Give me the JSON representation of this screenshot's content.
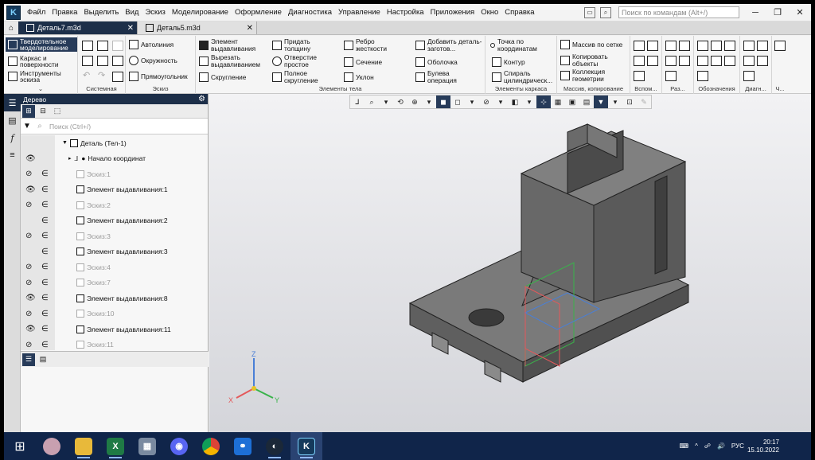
{
  "menu": {
    "items": [
      "Файл",
      "Правка",
      "Выделить",
      "Вид",
      "Эскиз",
      "Моделирование",
      "Оформление",
      "Диагностика",
      "Управление",
      "Настройка",
      "Приложения",
      "Окно",
      "Справка"
    ],
    "search_placeholder": "Поиск по командам (Alt+/)"
  },
  "tabs": [
    {
      "label": "Деталь7.m3d",
      "close": "✕",
      "active": true
    },
    {
      "label": "Деталь5.m3d",
      "close": "✕",
      "active": false
    }
  ],
  "ribbon": {
    "modes": [
      "Твердотельное моделирование",
      "Каркас и поверхности",
      "Инструменты эскиза"
    ],
    "system": {
      "title": "Системная"
    },
    "sketch": {
      "title": "Эскиз",
      "items": [
        "Автолиния",
        "Окружность",
        "Прямоугольник"
      ]
    },
    "body": {
      "title": "Элементы тела",
      "items": [
        "Элемент выдавливания",
        "Вырезать выдавливанием",
        "Скругление",
        "Придать толщину",
        "Отверстие простое",
        "Полное скругление",
        "Ребро жесткости",
        "Сечение",
        "Уклон",
        "Добавить деталь-заготов...",
        "Оболочка",
        "Булева операция"
      ]
    },
    "frame": {
      "title": "Элементы каркаса",
      "items": [
        "Точка по координатам",
        "Контур",
        "Спираль цилиндрическ..."
      ]
    },
    "array": {
      "title": "Массив, копирование",
      "items": [
        "Массив по сетке",
        "Копировать объекты",
        "Коллекция геометрии"
      ]
    },
    "aux": {
      "title": "Вспом..."
    },
    "sizes": {
      "title": "Раз..."
    },
    "marks": {
      "title": "Обозначения"
    },
    "diag": {
      "title": "Диагн..."
    },
    "more": {
      "title": "Ч..."
    }
  },
  "tree": {
    "title": "Дерево",
    "search_placeholder": "Поиск (Ctrl+/)",
    "root": "Деталь (Тел-1)",
    "origin": "Начало координат",
    "rows": [
      {
        "label": "Эскиз:1",
        "hidden": true,
        "dim": true
      },
      {
        "label": "Элемент выдавливания:1",
        "hidden": false,
        "dim": false
      },
      {
        "label": "Эскиз:2",
        "hidden": true,
        "dim": true
      },
      {
        "label": "Элемент выдавливания:2",
        "hidden": false,
        "dim": false,
        "noeye": true
      },
      {
        "label": "Эскиз:3",
        "hidden": true,
        "dim": true
      },
      {
        "label": "Элемент выдавливания:3",
        "hidden": false,
        "dim": false,
        "noeye": true
      },
      {
        "label": "Эскиз:4",
        "hidden": true,
        "dim": true
      },
      {
        "label": "Эскиз:7",
        "hidden": true,
        "dim": true
      },
      {
        "label": "Элемент выдавливания:8",
        "hidden": false,
        "dim": false
      },
      {
        "label": "Эскиз:10",
        "hidden": true,
        "dim": true
      },
      {
        "label": "Элемент выдавливания:11",
        "hidden": false,
        "dim": false
      },
      {
        "label": "Эскиз:11",
        "hidden": true,
        "dim": true
      }
    ]
  },
  "axes": {
    "x": "X",
    "y": "Y",
    "z": "Z"
  },
  "taskbar": {
    "lang": "РУС",
    "time": "20:17",
    "date": "15.10.2022"
  },
  "colors": {
    "accent": "#1d2f49",
    "taskbar": "#10254a",
    "model": "#6a6a6a"
  }
}
